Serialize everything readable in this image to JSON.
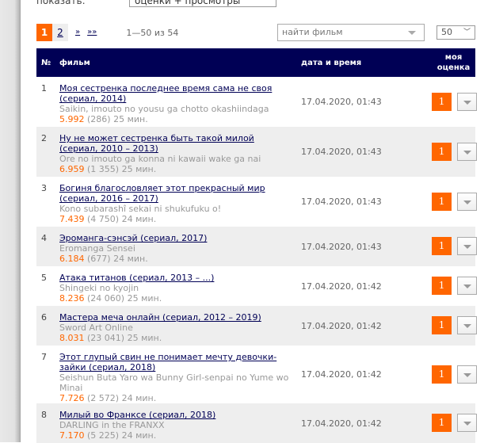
{
  "filter": {
    "label": "показать:",
    "selected": "оценки + просмотры"
  },
  "pagination": {
    "current": "1",
    "next_page": "2",
    "next": "»",
    "last": "»»",
    "range": "1—50 из 54"
  },
  "search": {
    "placeholder": "найти фильм"
  },
  "per_page": "50",
  "table": {
    "headers": {
      "num": "№",
      "film": "фильм",
      "date": "дата и время",
      "rating": "моя оценка"
    },
    "rows": [
      {
        "num": "1",
        "title": "Моя сестренка последнее время сама не своя (сериал, 2014)",
        "original": "Saikin, imouto no yousu ga chotto okashiindaga",
        "rating": "5.992",
        "votes": "(286) 25 мин.",
        "date": "17.04.2020, 01:43",
        "my_rating": "1"
      },
      {
        "num": "2",
        "title": "Ну не может сестренка быть такой милой (сериал, 2010 – 2013)",
        "original": "Ore no imouto ga konna ni kawaii wake ga nai",
        "rating": "6.959",
        "votes": "(1 355) 25 мин.",
        "date": "17.04.2020, 01:43",
        "my_rating": "1"
      },
      {
        "num": "3",
        "title": "Богиня благословляет этот прекрасный мир (сериал, 2016 – 2017)",
        "original": "Kono subarashî sekai ni shukufuku o!",
        "rating": "7.439",
        "votes": "(4 750) 24 мин.",
        "date": "17.04.2020, 01:43",
        "my_rating": "1"
      },
      {
        "num": "4",
        "title": "Эроманга-сэнсэй (сериал, 2017)",
        "original": "Eromanga Sensei",
        "rating": "6.184",
        "votes": "(677) 24 мин.",
        "date": "17.04.2020, 01:43",
        "my_rating": "1"
      },
      {
        "num": "5",
        "title": "Атака титанов (сериал, 2013 – ...)",
        "original": "Shingeki no kyojin",
        "rating": "8.236",
        "votes": "(24 060) 25 мин.",
        "date": "17.04.2020, 01:42",
        "my_rating": "1"
      },
      {
        "num": "6",
        "title": "Мастера меча онлайн (сериал, 2012 – 2019)",
        "original": "Sword Art Online",
        "rating": "8.031",
        "votes": "(23 041) 25 мин.",
        "date": "17.04.2020, 01:42",
        "my_rating": "1"
      },
      {
        "num": "7",
        "title": "Этот глупый свин не понимает мечту девочки-зайки (сериал, 2018)",
        "original": "Seishun Buta Yaro wa Bunny Girl-senpai no Yume wo Minai",
        "rating": "7.726",
        "votes": "(2 572) 24 мин.",
        "date": "17.04.2020, 01:42",
        "my_rating": "1"
      },
      {
        "num": "8",
        "title": "Милый во Франксе (сериал, 2018)",
        "original": "DARLING in the FRANXX",
        "rating": "7.170",
        "votes": "(5 225) 24 мин.",
        "date": "17.04.2020, 01:42",
        "my_rating": "1"
      }
    ]
  }
}
